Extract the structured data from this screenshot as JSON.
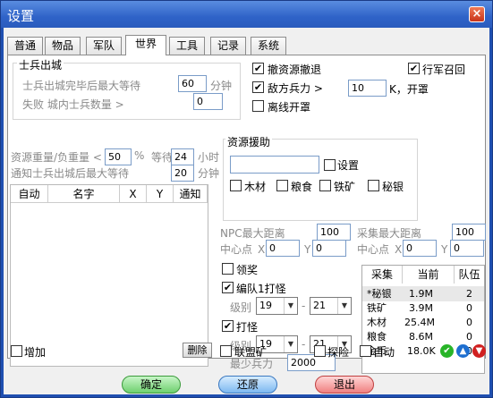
{
  "window": {
    "title": "设置",
    "close": "×"
  },
  "tabs": [
    "普通",
    "物品",
    "军队",
    "世界",
    "工具",
    "记录",
    "系统"
  ],
  "soldier": {
    "header": "士兵出城",
    "wait_label": "士兵出城完毕后最大等待",
    "wait_value": "60",
    "wait_unit": "分钟",
    "fail_label": "失败 城内士兵数量 >",
    "fail_value": "0"
  },
  "options": {
    "withdraw": {
      "label": "撤资源撤退",
      "checked": true
    },
    "recall": {
      "label": "行军召回",
      "checked": true
    },
    "enemy_label": "敌方兵力 >",
    "enemy_checked": true,
    "enemy_value": "10",
    "enemy_unit": "K，开罩",
    "offline": {
      "label": "离线开罩",
      "checked": false
    }
  },
  "resource_weight": {
    "label": "资源重量/负重量 <",
    "value": "50",
    "unit": "%",
    "wait_label": "等待",
    "wait_value": "24",
    "wait_unit": "小时",
    "notify_label": "通知士兵出城后最大等待",
    "notify_value": "20",
    "notify_unit": "分钟"
  },
  "aid": {
    "header": "资源援助",
    "input_value": "",
    "settings_label": "设置",
    "wood": "木材",
    "food": "粮食",
    "iron": "铁矿",
    "silver": "秘银"
  },
  "list_table": {
    "headers": [
      "自动",
      "名字",
      "X",
      "Y",
      "通知"
    ]
  },
  "npc": {
    "label": "NPC最大距离",
    "value": "100",
    "center_label": "中心点",
    "x_label": "X",
    "x_value": "0",
    "y_label": "Y",
    "y_value": "0"
  },
  "gather": {
    "label": "采集最大距离",
    "value": "100",
    "center_label": "中心点",
    "x_label": "X",
    "x_value": "0",
    "y_label": "Y",
    "y_value": "0"
  },
  "reward": {
    "label": "领奖",
    "checked": false
  },
  "team": {
    "label": "编队1打怪",
    "checked": true,
    "level_label": "级别",
    "from": "19",
    "dash": "-",
    "to": "21"
  },
  "monster": {
    "label": "打怪",
    "checked": true,
    "level_label": "级别",
    "from": "19",
    "dash": "-",
    "to": "21",
    "min_label": "最少兵力",
    "min_value": "2000"
  },
  "gather_table": {
    "headers": [
      "采集",
      "当前",
      "队伍"
    ],
    "rows": [
      {
        "name": "*秘银",
        "current": "1.9M",
        "team": "2"
      },
      {
        "name": "铁矿",
        "current": "3.9M",
        "team": "0"
      },
      {
        "name": "木材",
        "current": "25.4M",
        "team": "0"
      },
      {
        "name": "粮食",
        "current": "8.6M",
        "team": "0"
      },
      {
        "name": "金币",
        "current": "18.0K",
        "team": "0"
      }
    ]
  },
  "bottom": {
    "add_label": "增加",
    "delete_label": "删除",
    "alliance_label": "联盟矿",
    "explore_label": "探险",
    "auto_label": "自动"
  },
  "footer": {
    "ok": "确定",
    "restore": "还原",
    "exit": "退出"
  },
  "colors": {
    "accept": "#28b428",
    "up": "#1e6fd0",
    "down": "#d02020"
  }
}
